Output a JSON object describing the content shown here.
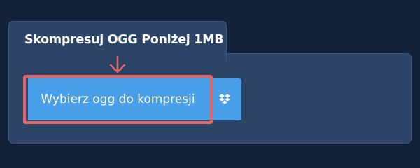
{
  "panel": {
    "title": "Skompresuj OGG Poniżej 1MB"
  },
  "upload": {
    "choose_label": "Wybierz ogg do kompresji",
    "dropbox_icon": "dropbox-icon"
  },
  "colors": {
    "background": "#13223a",
    "panel": "#2b4467",
    "button": "#4aa0e8",
    "highlight": "#e36565"
  }
}
